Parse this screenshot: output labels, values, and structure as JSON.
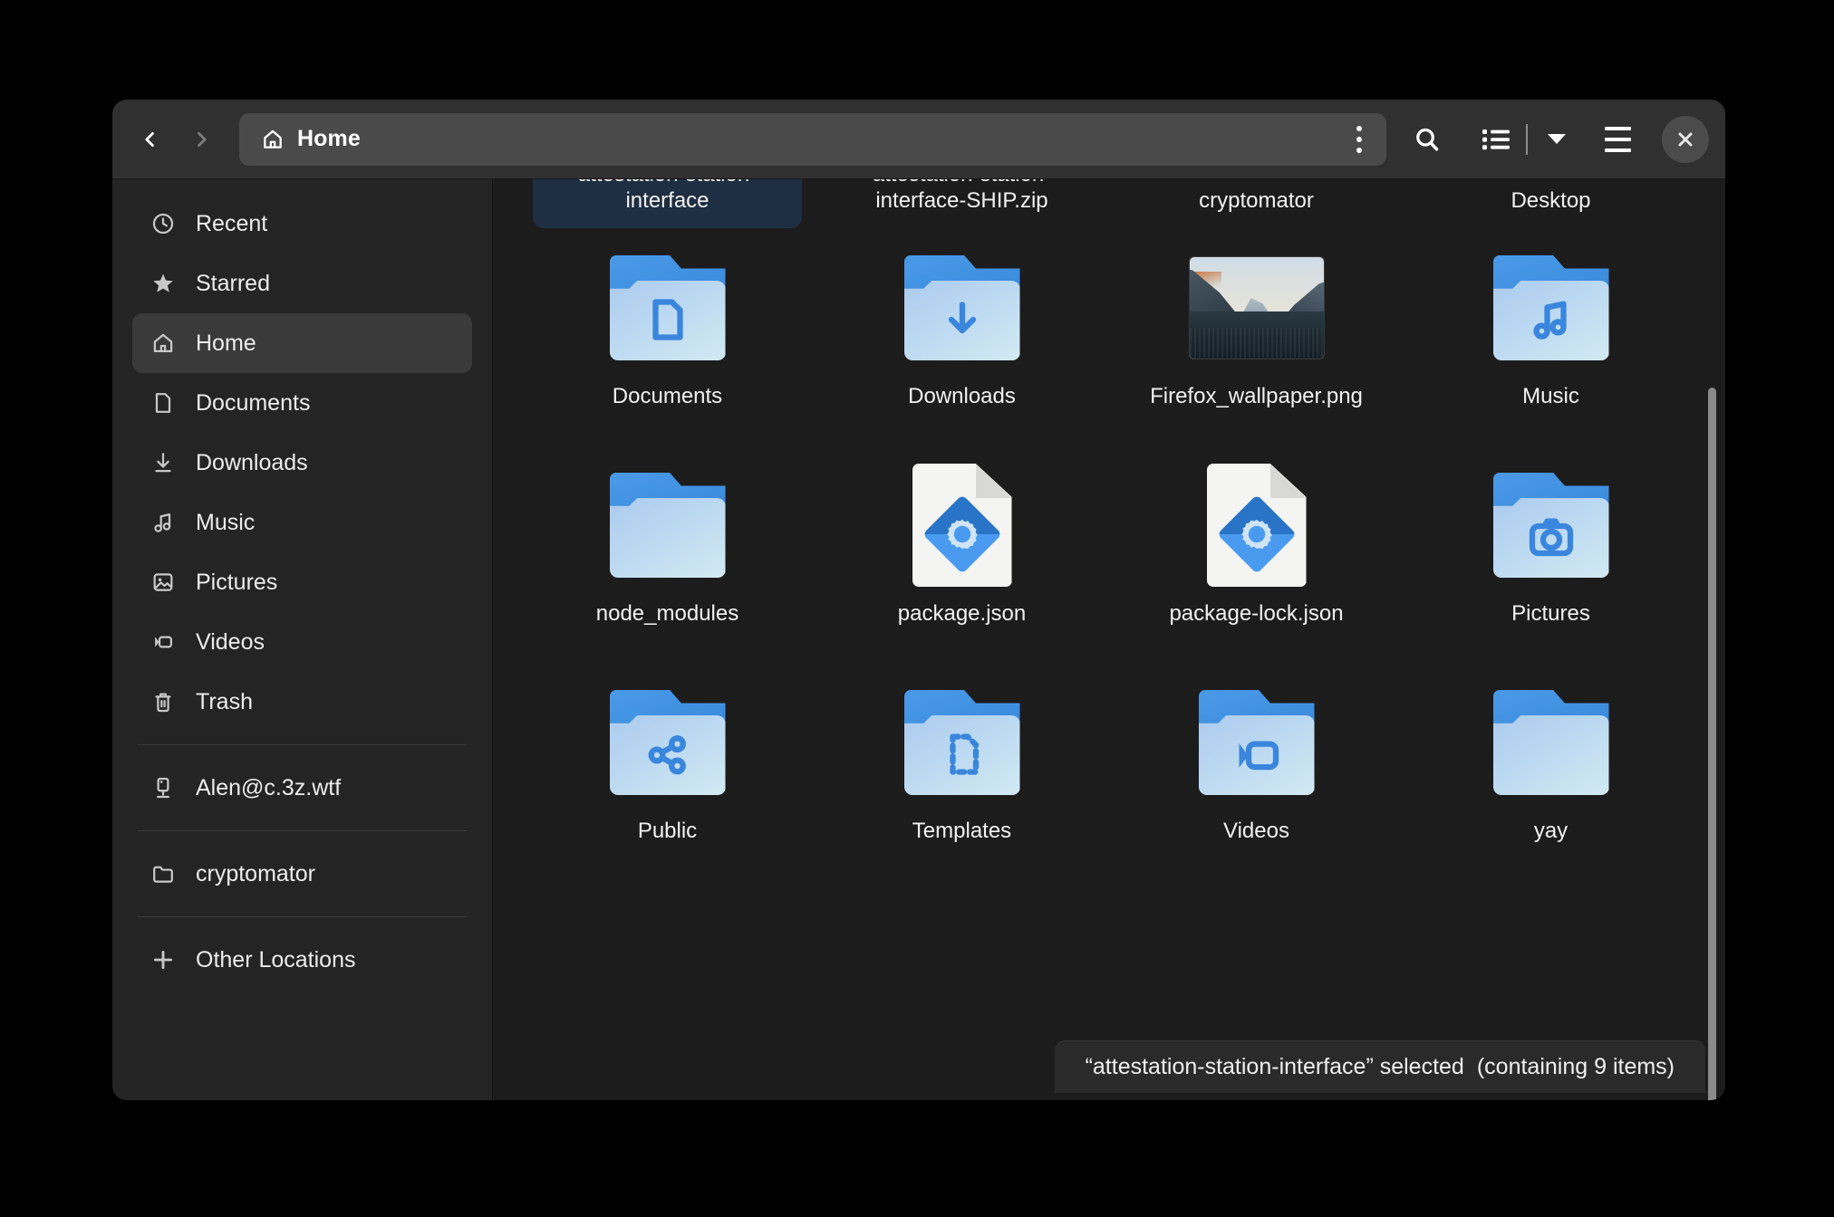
{
  "window": {
    "title": "Home"
  },
  "header": {
    "back_icon": "chevron-left-icon",
    "forward_icon": "chevron-right-icon",
    "path_icon": "home-icon",
    "path_label": "Home",
    "kebab_icon": "more-options-icon",
    "search_icon": "search-icon",
    "view_icon": "list-view-icon",
    "view_caret_icon": "chevron-down-icon",
    "menu_icon": "hamburger-menu-icon",
    "close_icon": "close-icon"
  },
  "sidebar": {
    "items": [
      {
        "label": "Recent",
        "icon": "clock-icon",
        "selected": false
      },
      {
        "label": "Starred",
        "icon": "star-icon",
        "selected": false
      },
      {
        "label": "Home",
        "icon": "home-icon",
        "selected": true
      },
      {
        "label": "Documents",
        "icon": "document-icon",
        "selected": false
      },
      {
        "label": "Downloads",
        "icon": "download-icon",
        "selected": false
      },
      {
        "label": "Music",
        "icon": "music-icon",
        "selected": false
      },
      {
        "label": "Pictures",
        "icon": "picture-icon",
        "selected": false
      },
      {
        "label": "Videos",
        "icon": "video-icon",
        "selected": false
      },
      {
        "label": "Trash",
        "icon": "trash-icon",
        "selected": false
      },
      {
        "label": "Alen@c.3z.wtf",
        "icon": "server-icon",
        "selected": false
      },
      {
        "label": "cryptomator",
        "icon": "folder-icon",
        "selected": false
      },
      {
        "label": "Other Locations",
        "icon": "plus-icon",
        "selected": false
      }
    ]
  },
  "content": {
    "items": [
      {
        "name": "attestation-station-interface",
        "kind": "folder",
        "emblem": "none",
        "selected": true,
        "clipped_top": true
      },
      {
        "name": "attestation-station-interface-SHIP.zip",
        "kind": "folder",
        "emblem": "none",
        "selected": false,
        "clipped_top": true
      },
      {
        "name": "cryptomator",
        "kind": "folder",
        "emblem": "none",
        "selected": false,
        "clipped_top": true
      },
      {
        "name": "Desktop",
        "kind": "folder",
        "emblem": "none",
        "selected": false,
        "clipped_top": true
      },
      {
        "name": "Documents",
        "kind": "folder",
        "emblem": "document",
        "selected": false
      },
      {
        "name": "Downloads",
        "kind": "folder",
        "emblem": "download",
        "selected": false
      },
      {
        "name": "Firefox_wallpaper.png",
        "kind": "image",
        "emblem": "none",
        "selected": false
      },
      {
        "name": "Music",
        "kind": "folder",
        "emblem": "music",
        "selected": false
      },
      {
        "name": "node_modules",
        "kind": "folder",
        "emblem": "none",
        "selected": false
      },
      {
        "name": "package.json",
        "kind": "json",
        "emblem": "none",
        "selected": false
      },
      {
        "name": "package-lock.json",
        "kind": "json",
        "emblem": "none",
        "selected": false
      },
      {
        "name": "Pictures",
        "kind": "folder",
        "emblem": "camera",
        "selected": false
      },
      {
        "name": "Public",
        "kind": "folder",
        "emblem": "share",
        "selected": false
      },
      {
        "name": "Templates",
        "kind": "folder",
        "emblem": "template",
        "selected": false
      },
      {
        "name": "Videos",
        "kind": "folder",
        "emblem": "video",
        "selected": false
      },
      {
        "name": "yay",
        "kind": "folder",
        "emblem": "none",
        "selected": false
      }
    ]
  },
  "statusbar": {
    "selection_text": "“attestation-station-interface” selected",
    "count_text": "(containing 9 items)"
  },
  "colors": {
    "window_bg": "#1e1e1e",
    "header_bg": "#303030",
    "sidebar_bg": "#242424",
    "content_bg": "#1c1c1c",
    "selection_bg": "#1f2e42",
    "folder_blue": "#2f7fd4",
    "emblem_blue": "#3b86dd"
  }
}
